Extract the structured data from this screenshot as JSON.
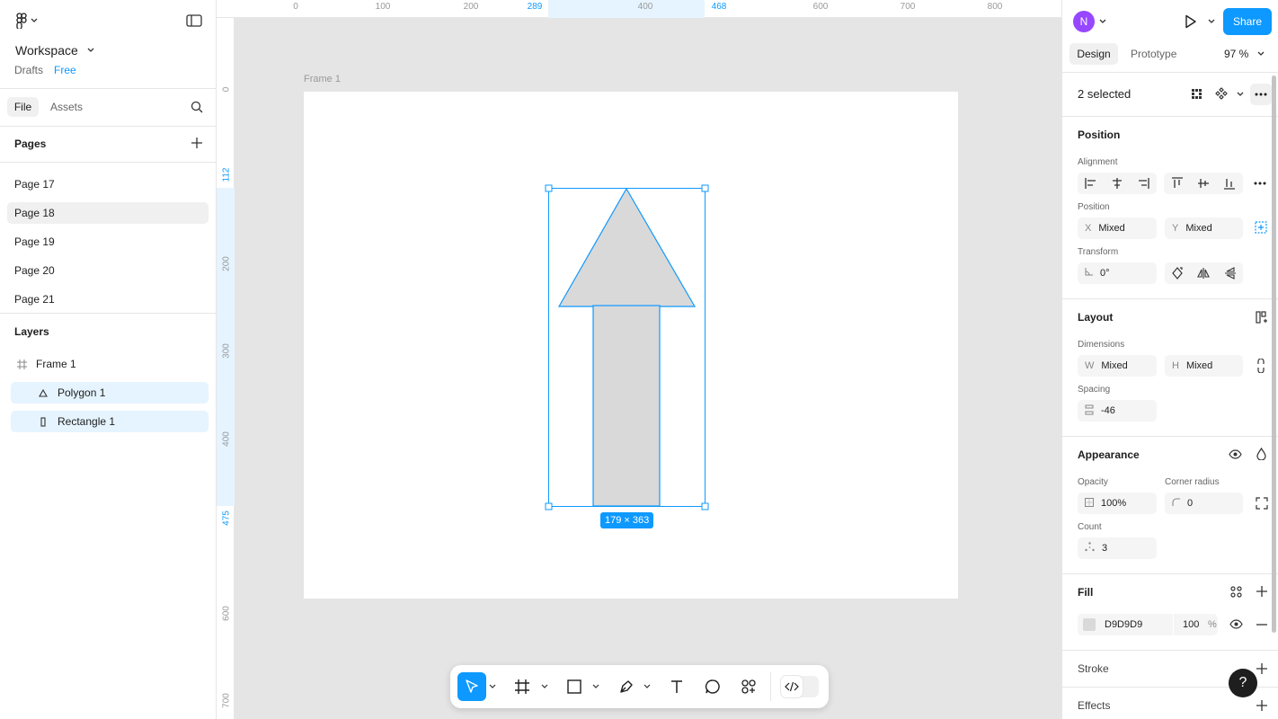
{
  "left": {
    "workspace": "Workspace",
    "drafts": "Drafts",
    "plan": "Free",
    "tabs": {
      "file": "File",
      "assets": "Assets"
    },
    "pages_title": "Pages",
    "pages": [
      "Page 17",
      "Page 18",
      "Page 19",
      "Page 20",
      "Page 21"
    ],
    "active_page": "Page 18",
    "layers_title": "Layers",
    "layers": [
      {
        "name": "Frame 1",
        "icon": "frame-icon",
        "selected": false
      },
      {
        "name": "Polygon 1",
        "icon": "polygon-icon",
        "selected": true
      },
      {
        "name": "Rectangle 1",
        "icon": "rectangle-icon",
        "selected": true
      }
    ]
  },
  "rulers": {
    "top": [
      "0",
      "100",
      "200",
      "289",
      "400",
      "468",
      "600",
      "700",
      "800"
    ],
    "left": [
      "0",
      "112",
      "200",
      "300",
      "400",
      "475",
      "600",
      "700"
    ]
  },
  "canvas": {
    "frame_label": "Frame 1",
    "size_badge": "179 × 363",
    "shape_fill": "#D9D9D9",
    "selection_color": "#0D99FF"
  },
  "right": {
    "avatar_initial": "N",
    "share": "Share",
    "tabs": {
      "design": "Design",
      "prototype": "Prototype"
    },
    "zoom": "97 %",
    "selection": "2 selected",
    "position": {
      "title": "Position",
      "alignment_label": "Alignment",
      "position_label": "Position",
      "x_prefix": "X",
      "x_value": "Mixed",
      "y_prefix": "Y",
      "y_value": "Mixed",
      "transform_label": "Transform",
      "rotation": "0°"
    },
    "layout": {
      "title": "Layout",
      "dimensions_label": "Dimensions",
      "w_prefix": "W",
      "w_value": "Mixed",
      "h_prefix": "H",
      "h_value": "Mixed",
      "spacing_label": "Spacing",
      "spacing_value": "-46"
    },
    "appearance": {
      "title": "Appearance",
      "opacity_label": "Opacity",
      "opacity_value": "100%",
      "radius_label": "Corner radius",
      "radius_value": "0",
      "count_label": "Count",
      "count_value": "3"
    },
    "fill": {
      "title": "Fill",
      "hex": "D9D9D9",
      "opacity": "100",
      "unit": "%"
    },
    "stroke_title": "Stroke",
    "effects_title": "Effects",
    "help": "?"
  }
}
